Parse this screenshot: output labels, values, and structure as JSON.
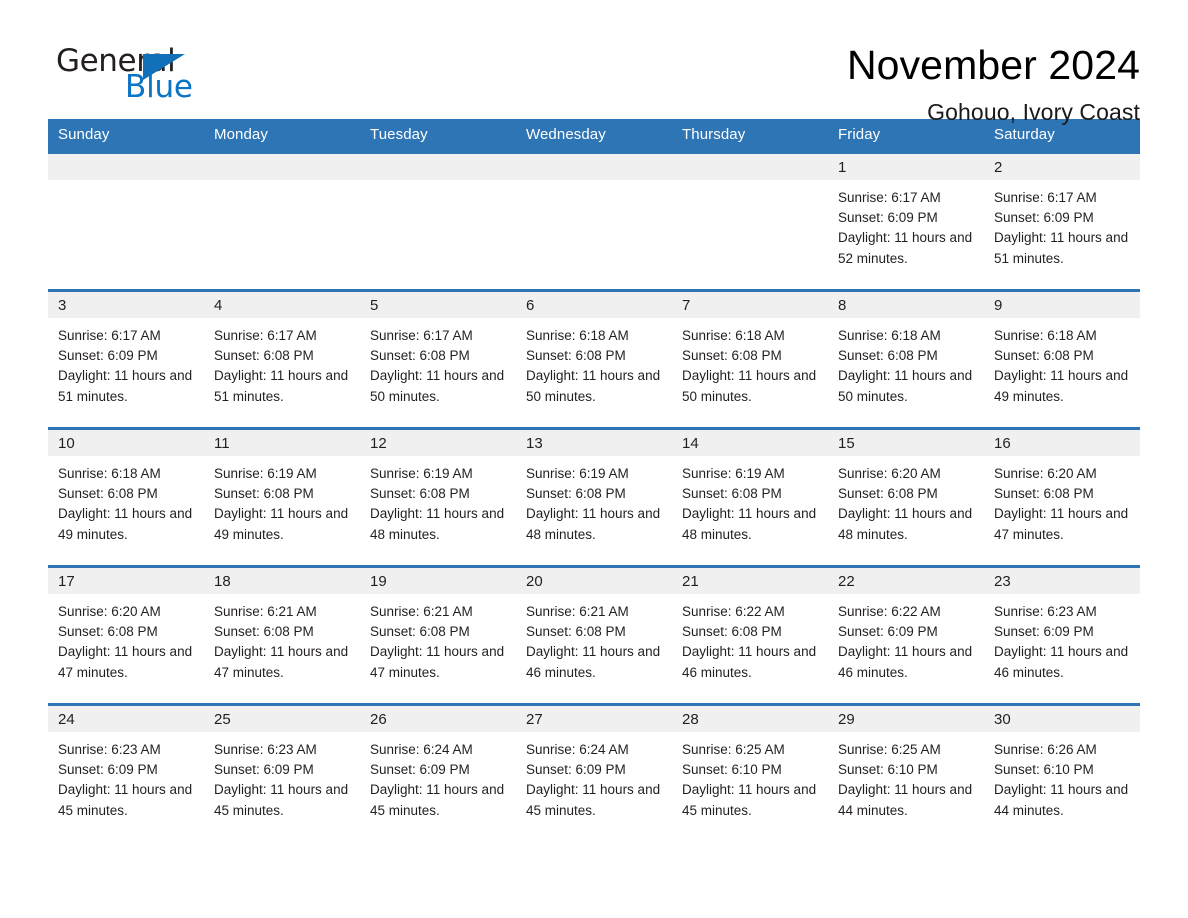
{
  "brand": {
    "name_part1": "General",
    "name_part2": "Blue",
    "triangle_icon": "blue-triangle-icon",
    "colors": {
      "general_text": "#231f20",
      "blue_text": "#0b74c4",
      "triangle": "#1270b8"
    }
  },
  "header": {
    "title": "November 2024",
    "subtitle": "Gohouo, Ivory Coast"
  },
  "theme": {
    "header_row_bg": "#2e75b6",
    "header_row_text": "#ffffff",
    "daynum_band_bg": "#f0f0f0",
    "cell_bg": "#ffffff",
    "row_divider": "#2e75b6",
    "body_text": "#231f20"
  },
  "calendar": {
    "month": "November",
    "year": "2024",
    "location": "Gohouo, Ivory Coast",
    "weekday_headers": [
      "Sunday",
      "Monday",
      "Tuesday",
      "Wednesday",
      "Thursday",
      "Friday",
      "Saturday"
    ],
    "weeks": [
      [
        {
          "day": "",
          "details": ""
        },
        {
          "day": "",
          "details": ""
        },
        {
          "day": "",
          "details": ""
        },
        {
          "day": "",
          "details": ""
        },
        {
          "day": "",
          "details": ""
        },
        {
          "day": "1",
          "details": "Sunrise: 6:17 AM\nSunset: 6:09 PM\nDaylight: 11 hours and 52 minutes."
        },
        {
          "day": "2",
          "details": "Sunrise: 6:17 AM\nSunset: 6:09 PM\nDaylight: 11 hours and 51 minutes."
        }
      ],
      [
        {
          "day": "3",
          "details": "Sunrise: 6:17 AM\nSunset: 6:09 PM\nDaylight: 11 hours and 51 minutes."
        },
        {
          "day": "4",
          "details": "Sunrise: 6:17 AM\nSunset: 6:08 PM\nDaylight: 11 hours and 51 minutes."
        },
        {
          "day": "5",
          "details": "Sunrise: 6:17 AM\nSunset: 6:08 PM\nDaylight: 11 hours and 50 minutes."
        },
        {
          "day": "6",
          "details": "Sunrise: 6:18 AM\nSunset: 6:08 PM\nDaylight: 11 hours and 50 minutes."
        },
        {
          "day": "7",
          "details": "Sunrise: 6:18 AM\nSunset: 6:08 PM\nDaylight: 11 hours and 50 minutes."
        },
        {
          "day": "8",
          "details": "Sunrise: 6:18 AM\nSunset: 6:08 PM\nDaylight: 11 hours and 50 minutes."
        },
        {
          "day": "9",
          "details": "Sunrise: 6:18 AM\nSunset: 6:08 PM\nDaylight: 11 hours and 49 minutes."
        }
      ],
      [
        {
          "day": "10",
          "details": "Sunrise: 6:18 AM\nSunset: 6:08 PM\nDaylight: 11 hours and 49 minutes."
        },
        {
          "day": "11",
          "details": "Sunrise: 6:19 AM\nSunset: 6:08 PM\nDaylight: 11 hours and 49 minutes."
        },
        {
          "day": "12",
          "details": "Sunrise: 6:19 AM\nSunset: 6:08 PM\nDaylight: 11 hours and 48 minutes."
        },
        {
          "day": "13",
          "details": "Sunrise: 6:19 AM\nSunset: 6:08 PM\nDaylight: 11 hours and 48 minutes."
        },
        {
          "day": "14",
          "details": "Sunrise: 6:19 AM\nSunset: 6:08 PM\nDaylight: 11 hours and 48 minutes."
        },
        {
          "day": "15",
          "details": "Sunrise: 6:20 AM\nSunset: 6:08 PM\nDaylight: 11 hours and 48 minutes."
        },
        {
          "day": "16",
          "details": "Sunrise: 6:20 AM\nSunset: 6:08 PM\nDaylight: 11 hours and 47 minutes."
        }
      ],
      [
        {
          "day": "17",
          "details": "Sunrise: 6:20 AM\nSunset: 6:08 PM\nDaylight: 11 hours and 47 minutes."
        },
        {
          "day": "18",
          "details": "Sunrise: 6:21 AM\nSunset: 6:08 PM\nDaylight: 11 hours and 47 minutes."
        },
        {
          "day": "19",
          "details": "Sunrise: 6:21 AM\nSunset: 6:08 PM\nDaylight: 11 hours and 47 minutes."
        },
        {
          "day": "20",
          "details": "Sunrise: 6:21 AM\nSunset: 6:08 PM\nDaylight: 11 hours and 46 minutes."
        },
        {
          "day": "21",
          "details": "Sunrise: 6:22 AM\nSunset: 6:08 PM\nDaylight: 11 hours and 46 minutes."
        },
        {
          "day": "22",
          "details": "Sunrise: 6:22 AM\nSunset: 6:09 PM\nDaylight: 11 hours and 46 minutes."
        },
        {
          "day": "23",
          "details": "Sunrise: 6:23 AM\nSunset: 6:09 PM\nDaylight: 11 hours and 46 minutes."
        }
      ],
      [
        {
          "day": "24",
          "details": "Sunrise: 6:23 AM\nSunset: 6:09 PM\nDaylight: 11 hours and 45 minutes."
        },
        {
          "day": "25",
          "details": "Sunrise: 6:23 AM\nSunset: 6:09 PM\nDaylight: 11 hours and 45 minutes."
        },
        {
          "day": "26",
          "details": "Sunrise: 6:24 AM\nSunset: 6:09 PM\nDaylight: 11 hours and 45 minutes."
        },
        {
          "day": "27",
          "details": "Sunrise: 6:24 AM\nSunset: 6:09 PM\nDaylight: 11 hours and 45 minutes."
        },
        {
          "day": "28",
          "details": "Sunrise: 6:25 AM\nSunset: 6:10 PM\nDaylight: 11 hours and 45 minutes."
        },
        {
          "day": "29",
          "details": "Sunrise: 6:25 AM\nSunset: 6:10 PM\nDaylight: 11 hours and 44 minutes."
        },
        {
          "day": "30",
          "details": "Sunrise: 6:26 AM\nSunset: 6:10 PM\nDaylight: 11 hours and 44 minutes."
        }
      ]
    ]
  }
}
